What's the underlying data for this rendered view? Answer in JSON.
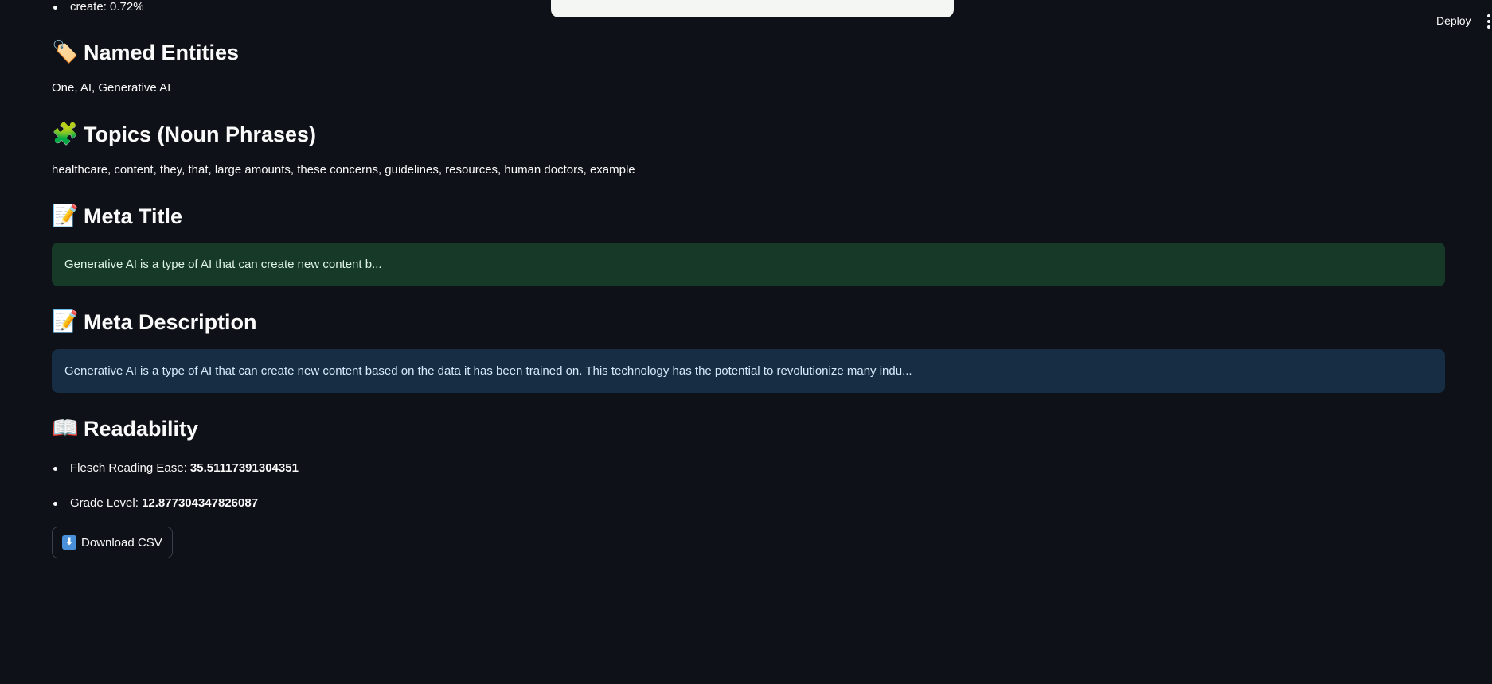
{
  "header": {
    "deploy_label": "Deploy",
    "menu_icon": "kebab-menu-icon"
  },
  "top_list": {
    "items": [
      {
        "label": "create:",
        "value": "0.72%"
      }
    ]
  },
  "sections": {
    "named_entities": {
      "emoji": "🏷️",
      "icon": "tag-icon",
      "title": "Named Entities",
      "text": "One, AI, Generative AI"
    },
    "topics": {
      "emoji": "🧩",
      "icon": "puzzle-piece-icon",
      "title": "Topics (Noun Phrases)",
      "text": "healthcare, content, they, that, large amounts, these concerns, guidelines, resources, human doctors, example"
    },
    "meta_title": {
      "emoji": "📝",
      "icon": "memo-icon",
      "title": "Meta Title",
      "text": "Generative AI is a type of AI that can create new content b..."
    },
    "meta_description": {
      "emoji": "📝",
      "icon": "memo-icon",
      "title": "Meta Description",
      "text": "Generative AI is a type of AI that can create new content based on the data it has been trained on. This technology has the potential to revolutionize many indu..."
    },
    "readability": {
      "emoji": "📖",
      "icon": "open-book-icon",
      "title": "Readability",
      "items": [
        {
          "label": "Flesch Reading Ease:",
          "value": "35.51117391304351"
        },
        {
          "label": "Grade Level:",
          "value": "12.877304347826087"
        }
      ]
    }
  },
  "download": {
    "icon": "down-arrow-icon",
    "glyph": "⬇",
    "label": "Download CSV"
  },
  "colors": {
    "background": "#0e1117",
    "success_bg": "#173928",
    "info_bg": "#172d43"
  }
}
